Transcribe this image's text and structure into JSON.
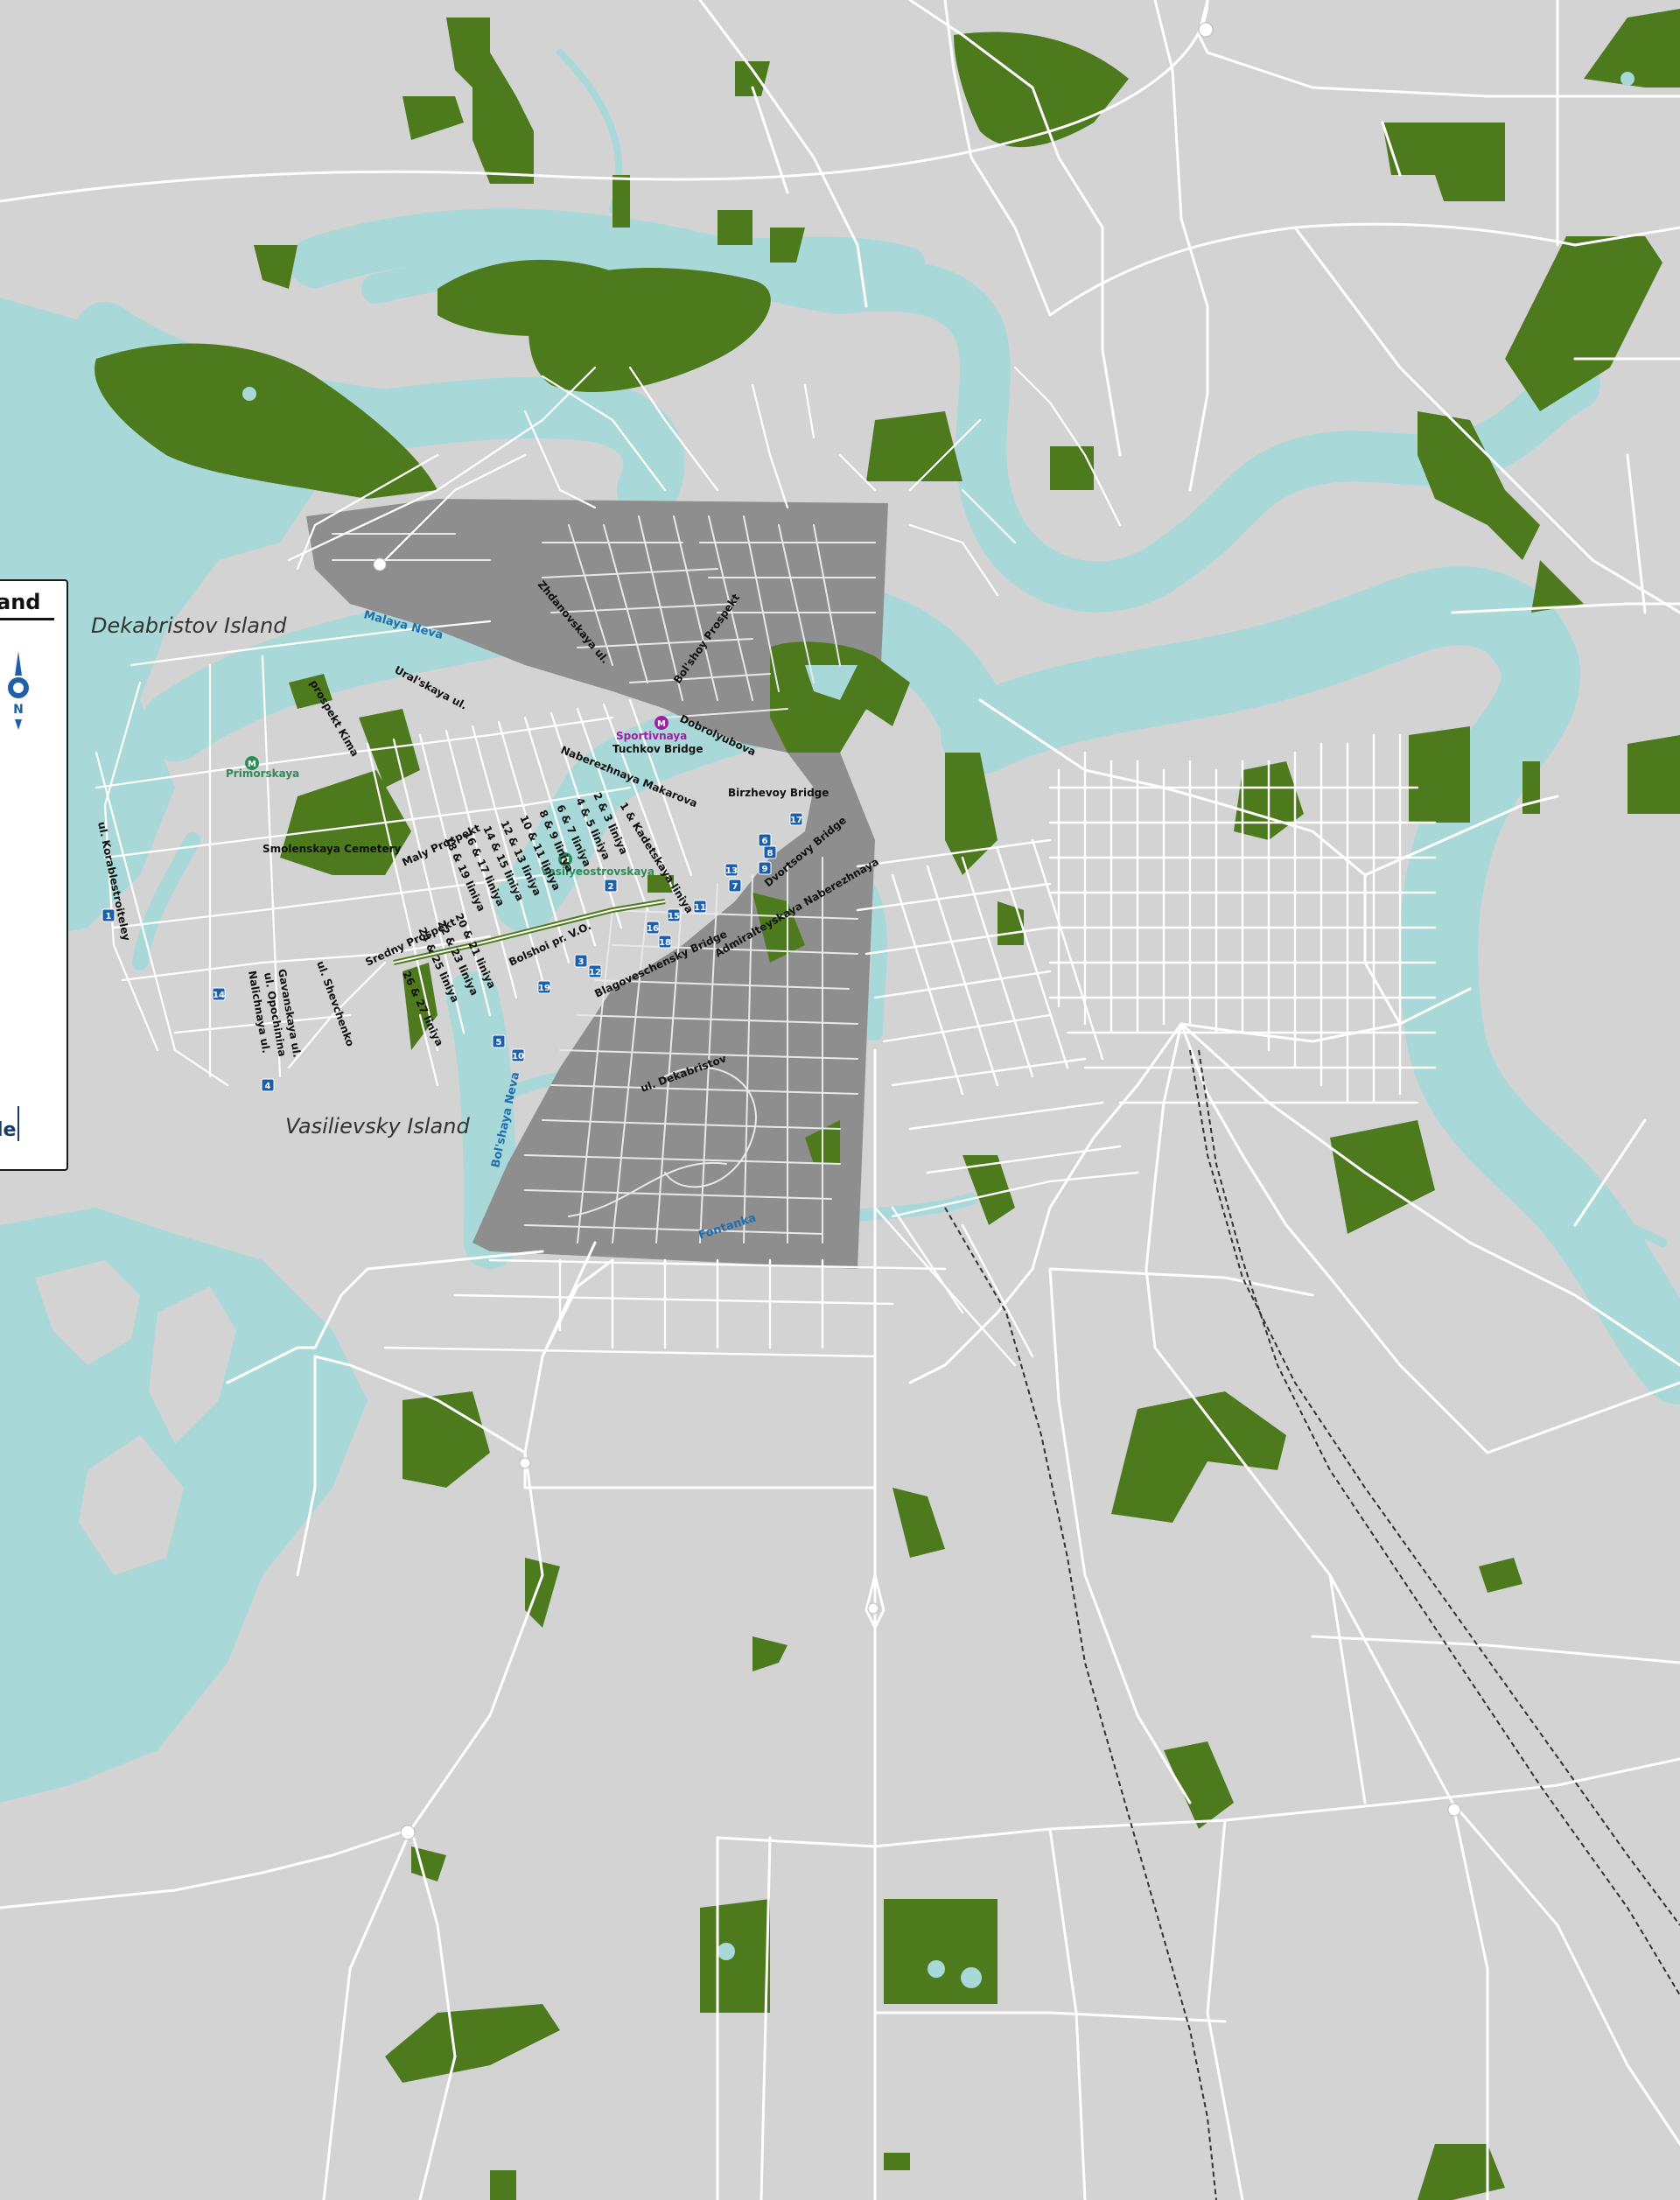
{
  "map": {
    "colors": {
      "land": "#d3d3d3",
      "water": "#a8d8d8",
      "park": "#4e7a1e",
      "district": "#8e8e8e",
      "road": "#ffffff",
      "rail": "#333333",
      "marker": "#1f5fa8"
    },
    "legend": {
      "title": "and",
      "scale_label": "le",
      "compass_letter": "N"
    },
    "islands": {
      "dekabristov": "Dekabristov Island",
      "vasilievsky": "Vasilievsky Island"
    },
    "water_labels": {
      "malaya_neva": "Malaya Neva",
      "bolshaya_neva": "Bol'shaya Neva",
      "fontanka": "Fontanka"
    },
    "metro": {
      "primorskaya": "Primorskaya",
      "vasileostrovskaya": "Vasilyeostrovskaya",
      "sportivnaya": "Sportivnaya"
    },
    "streets": {
      "zhdanovskaya": "Zhdanovskaya ul.",
      "bolshoy_prospekt_ps": "Bol'shoy Prospekt",
      "dobrolyubova": "Dobrolyubova",
      "tuchkov_bridge": "Tuchkov Bridge",
      "naberezhnaya_makarova": "Naberezhnaya Makarova",
      "birzhevoy_bridge": "Birzhevoy Bridge",
      "uralskaya": "Ural'skaya ul.",
      "prospekt_kima": "prospekt Kima",
      "smolenskaya_cemetery": "Smolenskaya Cemetery",
      "maly_prospekt": "Maly Prospekt",
      "sredny_prospekt": "Sredny Prospekt",
      "bolshoy_prospekt_vo": "Bolshoi pr. V.O.",
      "korablestroiteley": "ul. Korablestroiteley",
      "gavanskaya": "Gavanskaya ul.",
      "opochinina": "ul. Opochinina",
      "nalichnaya": "Nalichnaya ul.",
      "shevchenko": "ul. Shevchenko",
      "blagoveschensky_bridge": "Blagoveschensky Bridge",
      "admiralteyskaya": "Admiralteyskaya Naberezhnaya",
      "dvortsovy_bridge": "Dvortsovy Bridge",
      "kadetskaya": "1 & Kadetskaya liniya",
      "dekabristov_ul": "ul. Dekabristov"
    },
    "liniya": [
      "2 & 3 liniya",
      "4 & 5 liniya",
      "6 & 7 liniya",
      "8 & 9 liniya",
      "10 & 11 liniya",
      "12 & 13 liniya",
      "14 & 15 liniya",
      "16 & 17 liniya",
      "18 & 19 liniya",
      "20 & 21 liniya",
      "22 & 23 liniya",
      "24 & 25 liniya",
      "26 & 27 liniya"
    ],
    "markers": [
      "1",
      "2",
      "3",
      "4",
      "5",
      "6",
      "7",
      "8",
      "9",
      "10",
      "11",
      "12",
      "13",
      "14",
      "15",
      "16",
      "17",
      "18",
      "19"
    ]
  }
}
